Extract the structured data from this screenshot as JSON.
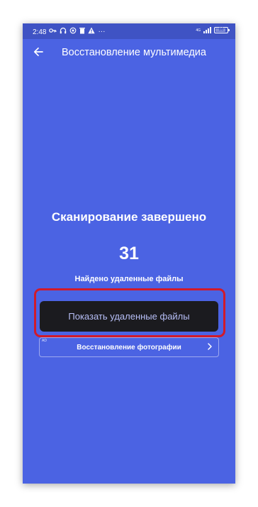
{
  "status_bar": {
    "time": "2:48",
    "network_label": "4G",
    "battery_percent": "86",
    "battery_level": 0.86,
    "icons": [
      "vpn-key-icon",
      "headphones-icon",
      "location-icon",
      "trash-icon",
      "warning-icon",
      "more-icon"
    ],
    "more": "···"
  },
  "app_bar": {
    "title": "Восстановление мультимедиа",
    "back_icon": "arrow-left-icon"
  },
  "main": {
    "scan_title": "Сканирование завершено",
    "count": "31",
    "found_label": "Найдено удаленные файлы",
    "show_button_label": "Показать удаленные файлы",
    "highlight_color": "#d11a2a"
  },
  "ad": {
    "badge": "AD",
    "label": "Восстановление фотографии",
    "chevron_icon": "chevron-right-icon"
  },
  "colors": {
    "background": "#4b63e3",
    "status_bar": "#3f53c4",
    "button": "#1b1b1f",
    "button_text": "#b7bff7"
  }
}
